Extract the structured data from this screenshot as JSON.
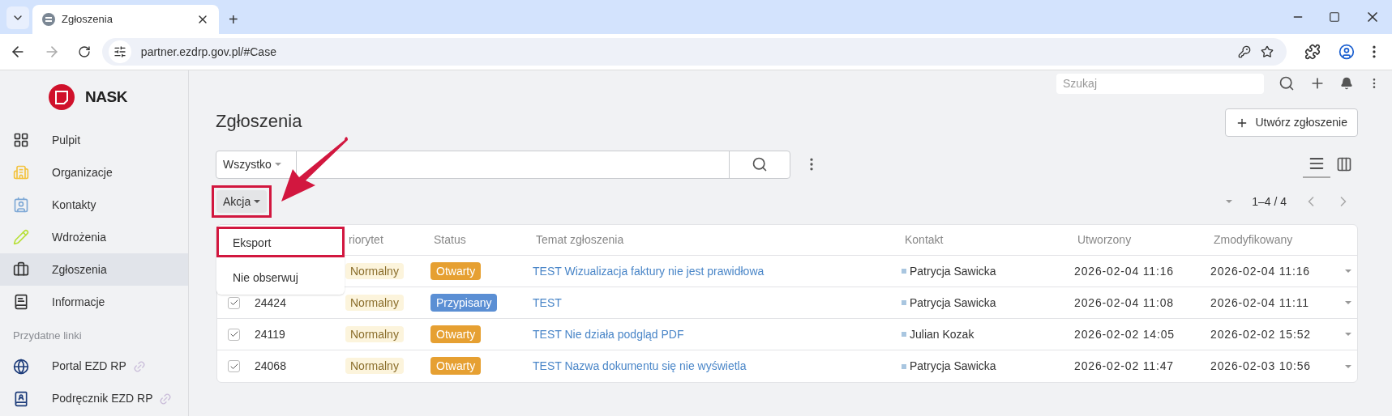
{
  "browser": {
    "tabs": [
      {
        "title": "Zgłoszenia",
        "selected": true
      }
    ],
    "new_tab": "+",
    "url": "partner.ezdrp.gov.pl/#Case"
  },
  "sidebar": {
    "logo": "NASK",
    "items": [
      {
        "label": "Pulpit",
        "kind": "grid",
        "selected": false
      },
      {
        "label": "Organizacje",
        "kind": "building",
        "selected": false
      },
      {
        "label": "Kontakty",
        "kind": "contact",
        "selected": false
      },
      {
        "label": "Wdrożenia",
        "kind": "pencil",
        "selected": false
      },
      {
        "label": "Zgłoszenia",
        "kind": "briefcase",
        "selected": true
      },
      {
        "label": "Informacje",
        "kind": "book",
        "selected": false
      }
    ],
    "section": "Przydatne linki",
    "links": [
      {
        "label": "Portal EZD RP",
        "kind": "globe"
      },
      {
        "label": "Podręcznik EZD RP",
        "kind": "manual"
      }
    ]
  },
  "topbar": {
    "search": {
      "placeholder": "Szukaj"
    }
  },
  "page": {
    "title": "Zgłoszenia",
    "create_button": "Utwórz zgłoszenie",
    "filter": "Wszystko",
    "views": [
      {
        "kind": "list",
        "selected": true
      },
      {
        "kind": "board",
        "selected": false
      }
    ],
    "action_button": {
      "label": "Akcja",
      "highlighted": true
    },
    "menu": [
      {
        "label": "Eksport",
        "highlighted": true
      },
      {
        "label": "Nie obserwuj",
        "highlighted": false
      }
    ],
    "pagination": "1–4 / 4"
  },
  "table": {
    "columns": [
      "riorytet",
      "Status",
      "Temat zgłoszenia",
      "Kontakt",
      "Utworzony",
      "Zmodyfikowany"
    ],
    "rows": [
      {
        "priority": "Normalny",
        "status": "Otwarty",
        "color": "#e6a032",
        "subject": "TEST Wizualizacja faktury nie jest prawidłowa",
        "contact": "Patrycja Sawicka",
        "created": "2026-02-04 11:16",
        "modified": "2026-02-04 11:16"
      },
      {
        "checked": true,
        "id": "24424",
        "priority": "Normalny",
        "status": "Przypisany",
        "color": "#5b8fd4",
        "subject": "TEST",
        "contact": "Patrycja Sawicka",
        "created": "2026-02-04 11:08",
        "modified": "2026-02-04 11:11"
      },
      {
        "checked": true,
        "id": "24119",
        "priority": "Normalny",
        "status": "Otwarty",
        "color": "#e6a032",
        "subject": "TEST Nie działa podgląd PDF",
        "contact": "Julian Kozak",
        "created": "2026-02-02 14:05",
        "modified": "2026-02-02 15:52"
      },
      {
        "checked": true,
        "id": "24068",
        "priority": "Normalny",
        "status": "Otwarty",
        "color": "#e6a032",
        "subject": "TEST Nazwa dokumentu się nie wyświetla",
        "contact": "Patrycja Sawicka",
        "created": "2026-02-02 11:47",
        "modified": "2026-02-03 10:56"
      }
    ]
  }
}
